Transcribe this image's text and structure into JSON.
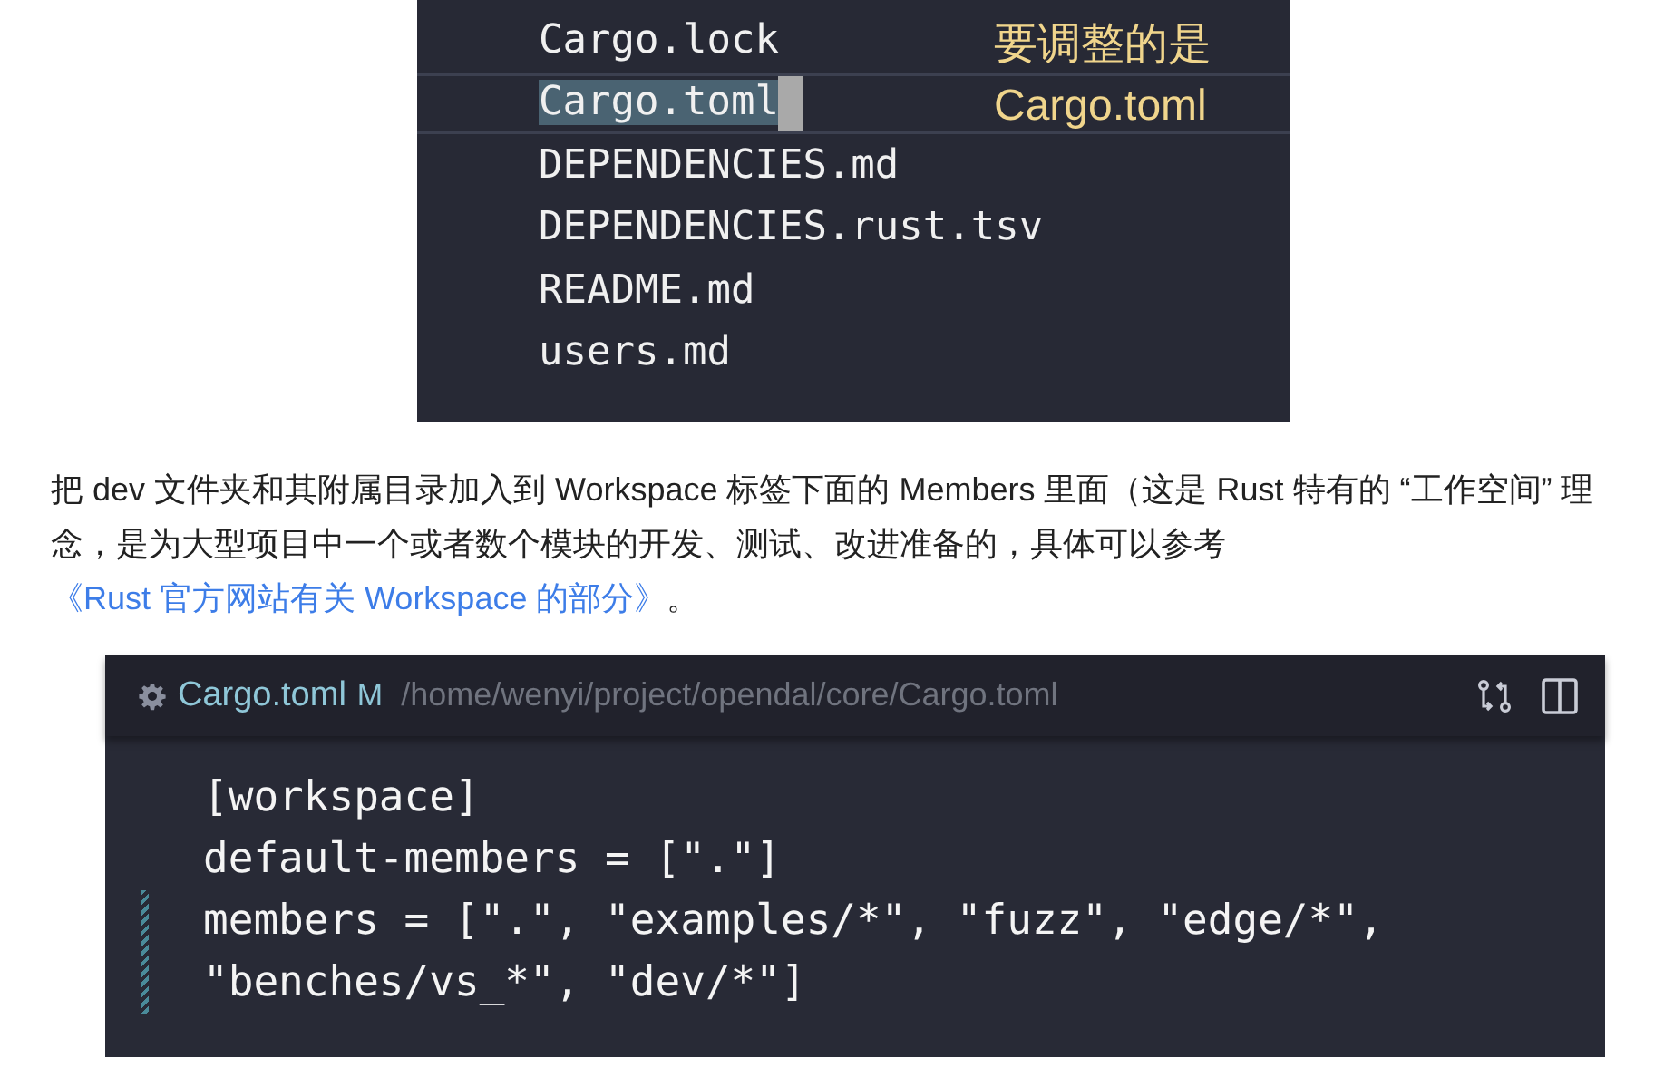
{
  "file_list": {
    "files": [
      {
        "name": "Cargo.lock",
        "selected": false
      },
      {
        "name": "Cargo.toml",
        "selected": true
      },
      {
        "name": "DEPENDENCIES.md",
        "selected": false
      },
      {
        "name": "DEPENDENCIES.rust.tsv",
        "selected": false
      },
      {
        "name": "README.md",
        "selected": false
      },
      {
        "name": "users.md",
        "selected": false
      }
    ],
    "annotation": [
      "要调整的是",
      "Cargo.toml"
    ]
  },
  "paragraph": {
    "text": "把 dev 文件夹和其附属目录加入到 Workspace 标签下面的 Members 里面（这是 Rust 特有的 “工作空间” 理念，是为大型项目中一个或者数个模块的开发、测试、改进准备的，具体可以参考 ",
    "link": "《Rust 官方网站有关 Workspace 的部分》",
    "end": "。"
  },
  "editor": {
    "tab": {
      "title": "Cargo.toml",
      "status": "M",
      "path": "/home/wenyi/project/opendal/core/Cargo.toml"
    },
    "lines": [
      {
        "text": "[workspace]",
        "modified": false
      },
      {
        "text": "default-members = [\".\"]",
        "modified": false
      },
      {
        "text": "members = [\".\", \"examples/*\", \"fuzz\", \"edge/*\",",
        "modified": true
      },
      {
        "text": "\"benches/vs_*\", \"dev/*\"]",
        "modified": true
      }
    ]
  }
}
